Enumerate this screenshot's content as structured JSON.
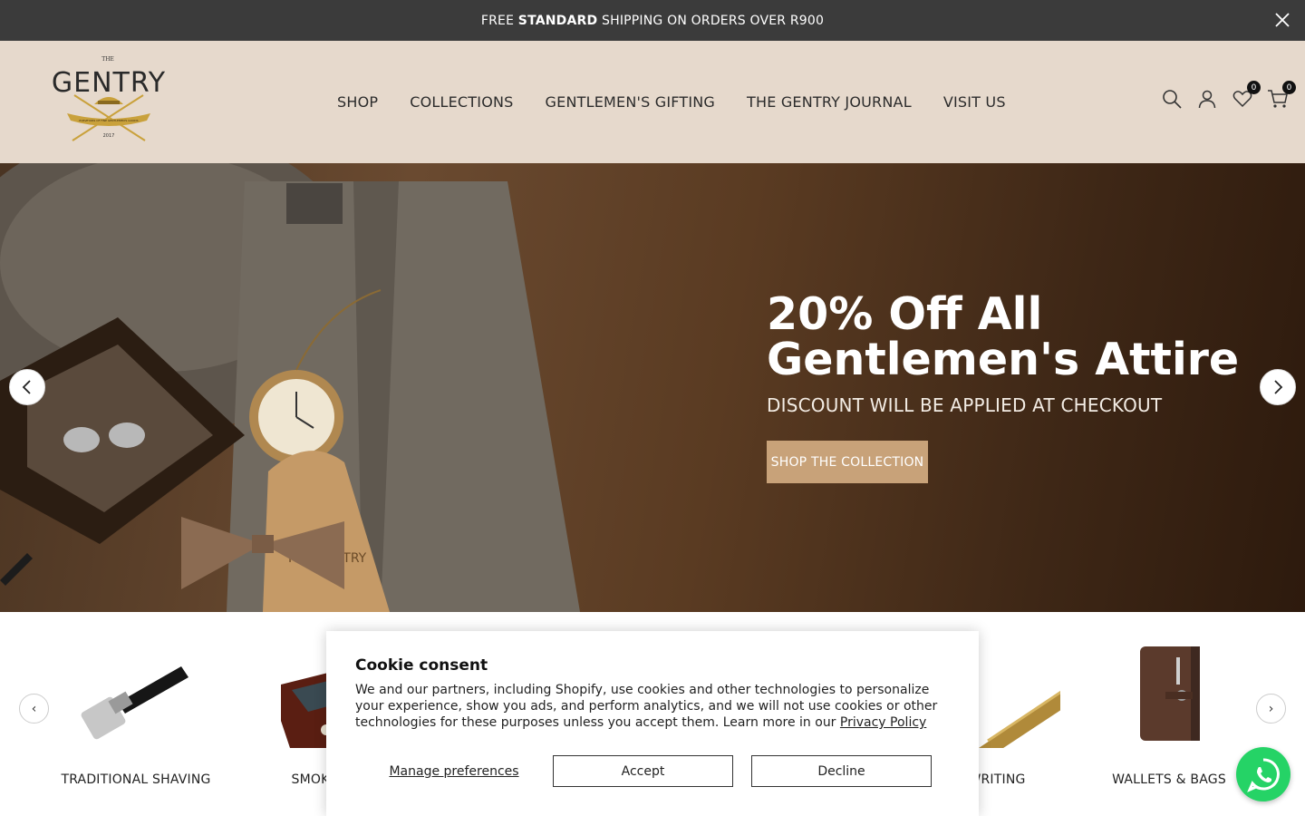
{
  "announcement": {
    "prefix": "FREE ",
    "bold": "STANDARD",
    "suffix": " SHIPPING ON ORDERS OVER R900"
  },
  "header": {
    "logo": {
      "top": "THE",
      "name": "GENTRY",
      "ribbon": "PURVEYORS OF FINE GENTLEMEN'S GOODS",
      "est": "2017"
    },
    "nav": [
      "SHOP",
      "COLLECTIONS",
      "GENTLEMEN'S GIFTING",
      "THE GENTRY JOURNAL",
      "VISIT US"
    ],
    "wishlist_count": "0",
    "cart_count": "0",
    "icons": [
      "search-icon",
      "account-icon",
      "heart-icon",
      "cart-icon"
    ]
  },
  "hero": {
    "title_line1": "20% Off All",
    "title_line2": "Gentlemen's Attire",
    "subtitle": "DISCOUNT WILL BE APPLIED AT CHECKOUT",
    "button": "SHOP THE COLLECTION",
    "tag_text": "THE GENTRY"
  },
  "categories": [
    "TRADITIONAL SHAVING",
    "SMOKIN",
    "WRITING",
    "WALLETS & BAGS"
  ],
  "cookie": {
    "title": "Cookie consent",
    "body": "We and our partners, including Shopify, use cookies and other technologies to personalize your experience, show you ads, and perform analytics, and we will not use cookies or other technologies for these purposes unless you accept them. Learn more in our ",
    "link": "Privacy Policy",
    "manage": "Manage preferences",
    "accept": "Accept",
    "decline": "Decline"
  },
  "colors": {
    "announcement_bg": "#3b3b3b",
    "header_bg": "#e6d9cc",
    "button_bg": "#c8a279",
    "whatsapp": "#25d366"
  }
}
